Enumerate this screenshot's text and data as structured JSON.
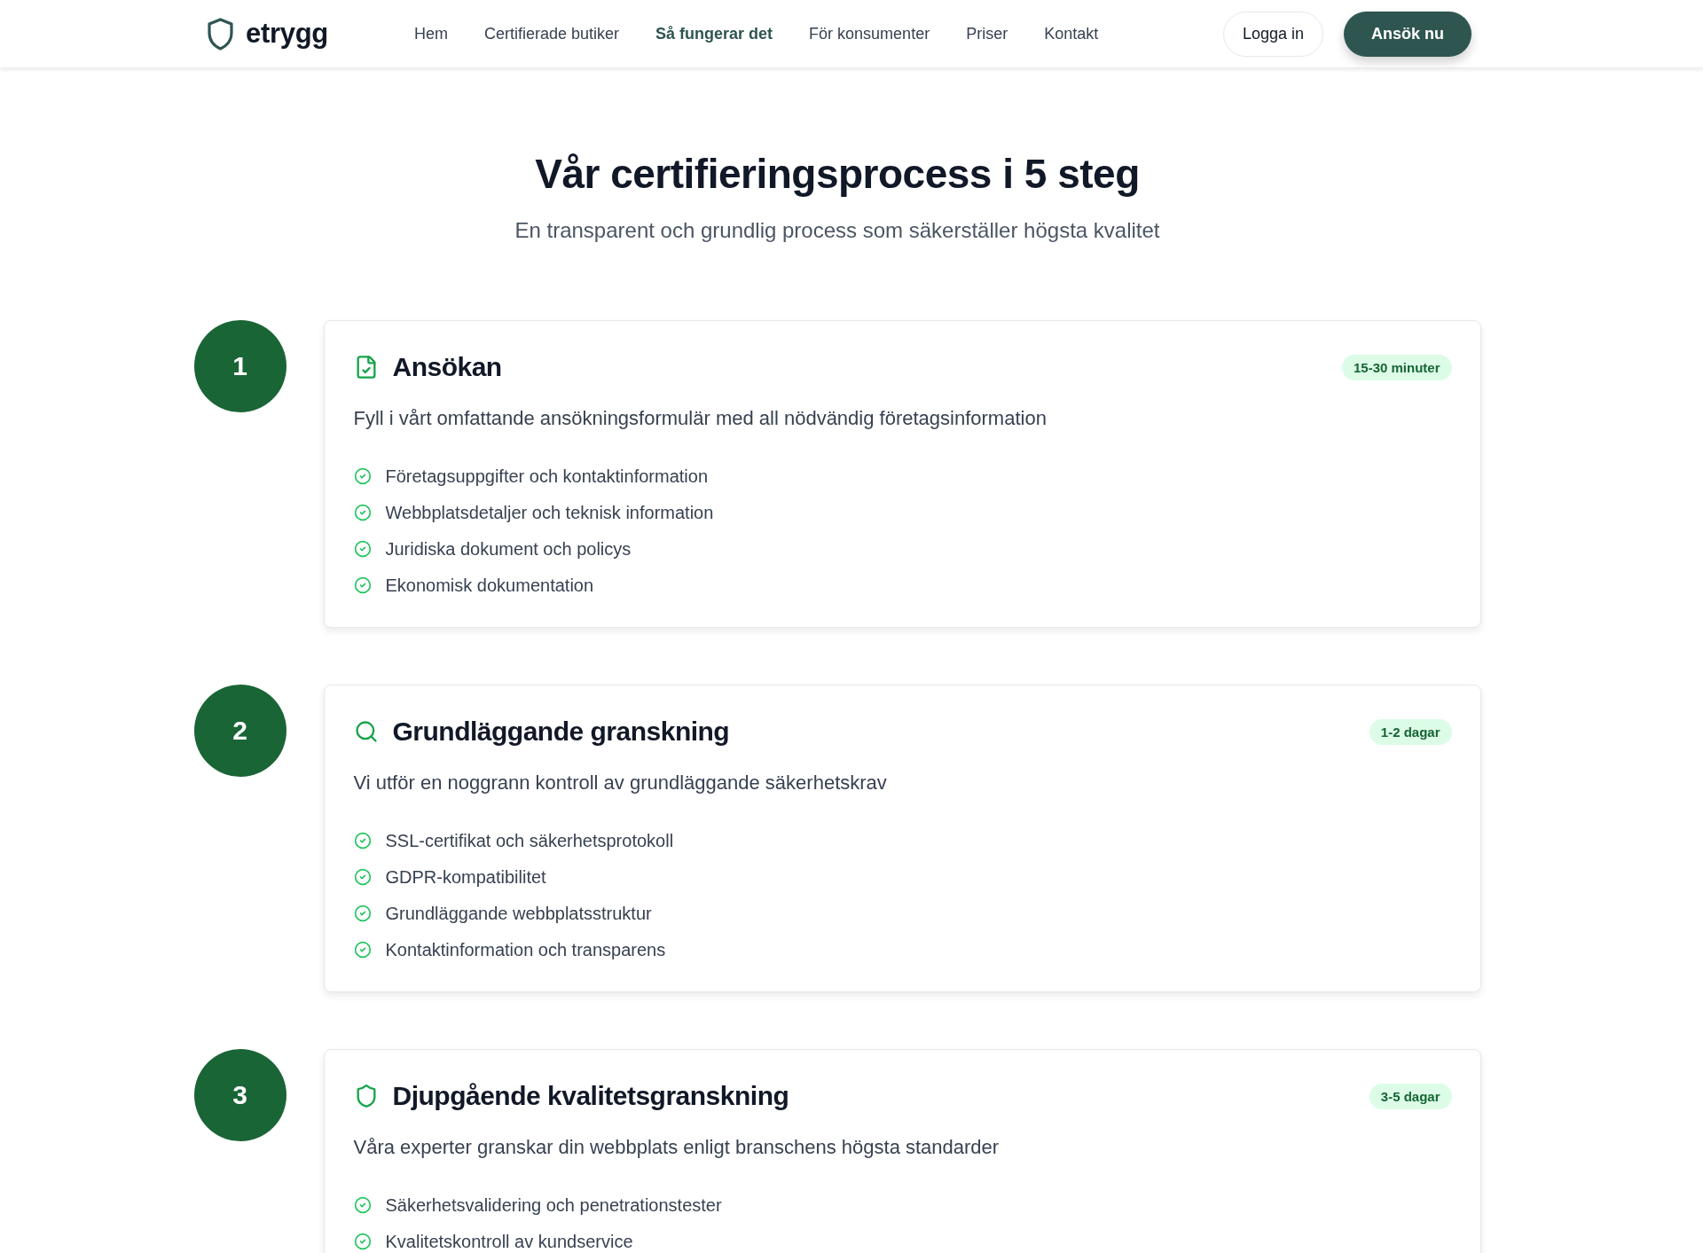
{
  "header": {
    "logo": "etrygg",
    "nav": [
      {
        "label": "Hem",
        "selected": false
      },
      {
        "label": "Certifierade butiker",
        "selected": false
      },
      {
        "label": "Så fungerar det",
        "selected": true
      },
      {
        "label": "För konsumenter",
        "selected": false
      },
      {
        "label": "Priser",
        "selected": false
      },
      {
        "label": "Kontakt",
        "selected": false
      }
    ],
    "login_button": "Logga in",
    "apply_button": "Ansök nu"
  },
  "hero": {
    "title": "Vår certifieringsprocess i 5 steg",
    "subtitle": "En transparent och grundlig process som säkerställer högsta kvalitet"
  },
  "steps": [
    {
      "number": "1",
      "title": "Ansökan",
      "duration": "15-30 minuter",
      "description": "Fyll i vårt omfattande ansökningsformulär med all nödvändig företagsinformation",
      "items": [
        "Företagsuppgifter och kontaktinformation",
        "Webbplatsdetaljer och teknisk information",
        "Juridiska dokument och policys",
        "Ekonomisk dokumentation"
      ]
    },
    {
      "number": "2",
      "title": "Grundläggande granskning",
      "duration": "1-2 dagar",
      "description": "Vi utför en noggrann kontroll av grundläggande säkerhetskrav",
      "items": [
        "SSL-certifikat och säkerhetsprotokoll",
        "GDPR-kompatibilitet",
        "Grundläggande webbplatsstruktur",
        "Kontaktinformation och transparens"
      ]
    },
    {
      "number": "3",
      "title": "Djupgående kvalitetsgranskning",
      "duration": "3-5 dagar",
      "description": "Våra experter granskar din webbplats enligt branschens högsta standarder",
      "items": [
        "Säkerhetsvalidering och penetrationstester",
        "Kvalitetskontroll av kundservice"
      ]
    }
  ]
}
